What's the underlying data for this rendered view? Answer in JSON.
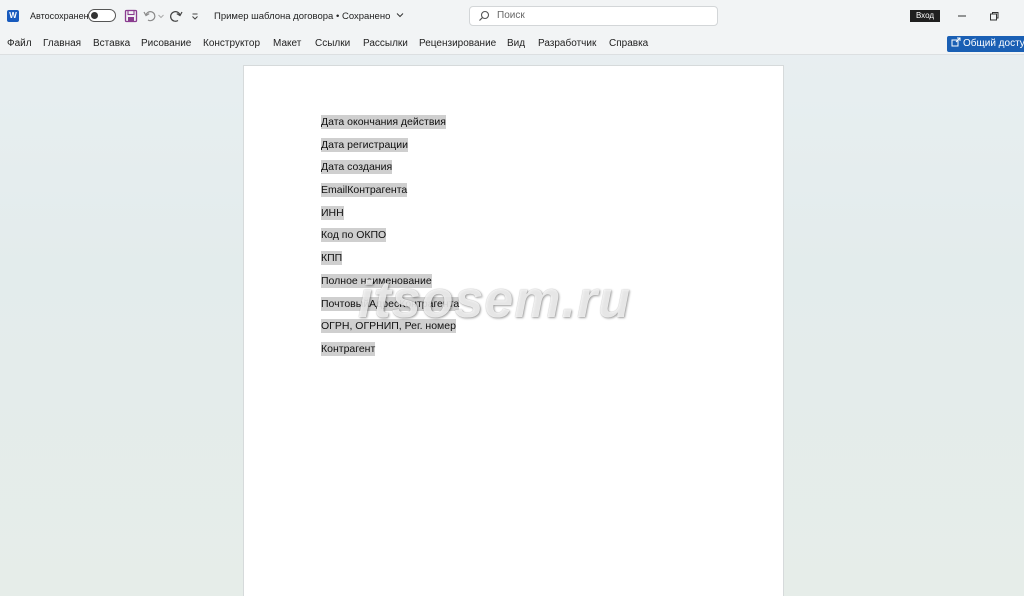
{
  "app": {
    "logo_letter": "W"
  },
  "titlebar": {
    "autosave_label": "Автосохранение",
    "doc_title": "Пример шаблона договора",
    "doc_status": "Сохранено",
    "search_placeholder": "Поиск",
    "signin_label": "Вход"
  },
  "ribbon": {
    "tabs": [
      {
        "label": "Файл"
      },
      {
        "label": "Главная"
      },
      {
        "label": "Вставка"
      },
      {
        "label": "Рисование"
      },
      {
        "label": "Конструктор"
      },
      {
        "label": "Макет"
      },
      {
        "label": "Ссылки"
      },
      {
        "label": "Рассылки"
      },
      {
        "label": "Рецензирование"
      },
      {
        "label": "Вид"
      },
      {
        "label": "Разработчик"
      },
      {
        "label": "Справка"
      }
    ],
    "share_label": "Общий доступ"
  },
  "document": {
    "fields": [
      "Дата окончания действия",
      "Дата регистрации",
      "Дата создания",
      "EmailКонтрагента",
      "ИНН",
      "Код по ОКПО",
      "КПП",
      "Полное наименование",
      "ПочтовыйАдресКонтрагента",
      "ОГРН, ОГРНИП, Рег. номер",
      "Контрагент"
    ]
  },
  "watermark": "itsosem.ru",
  "colors": {
    "accent": "#1a5fb4",
    "field_highlight": "#cfcfcf",
    "word_blue": "#185abd"
  }
}
